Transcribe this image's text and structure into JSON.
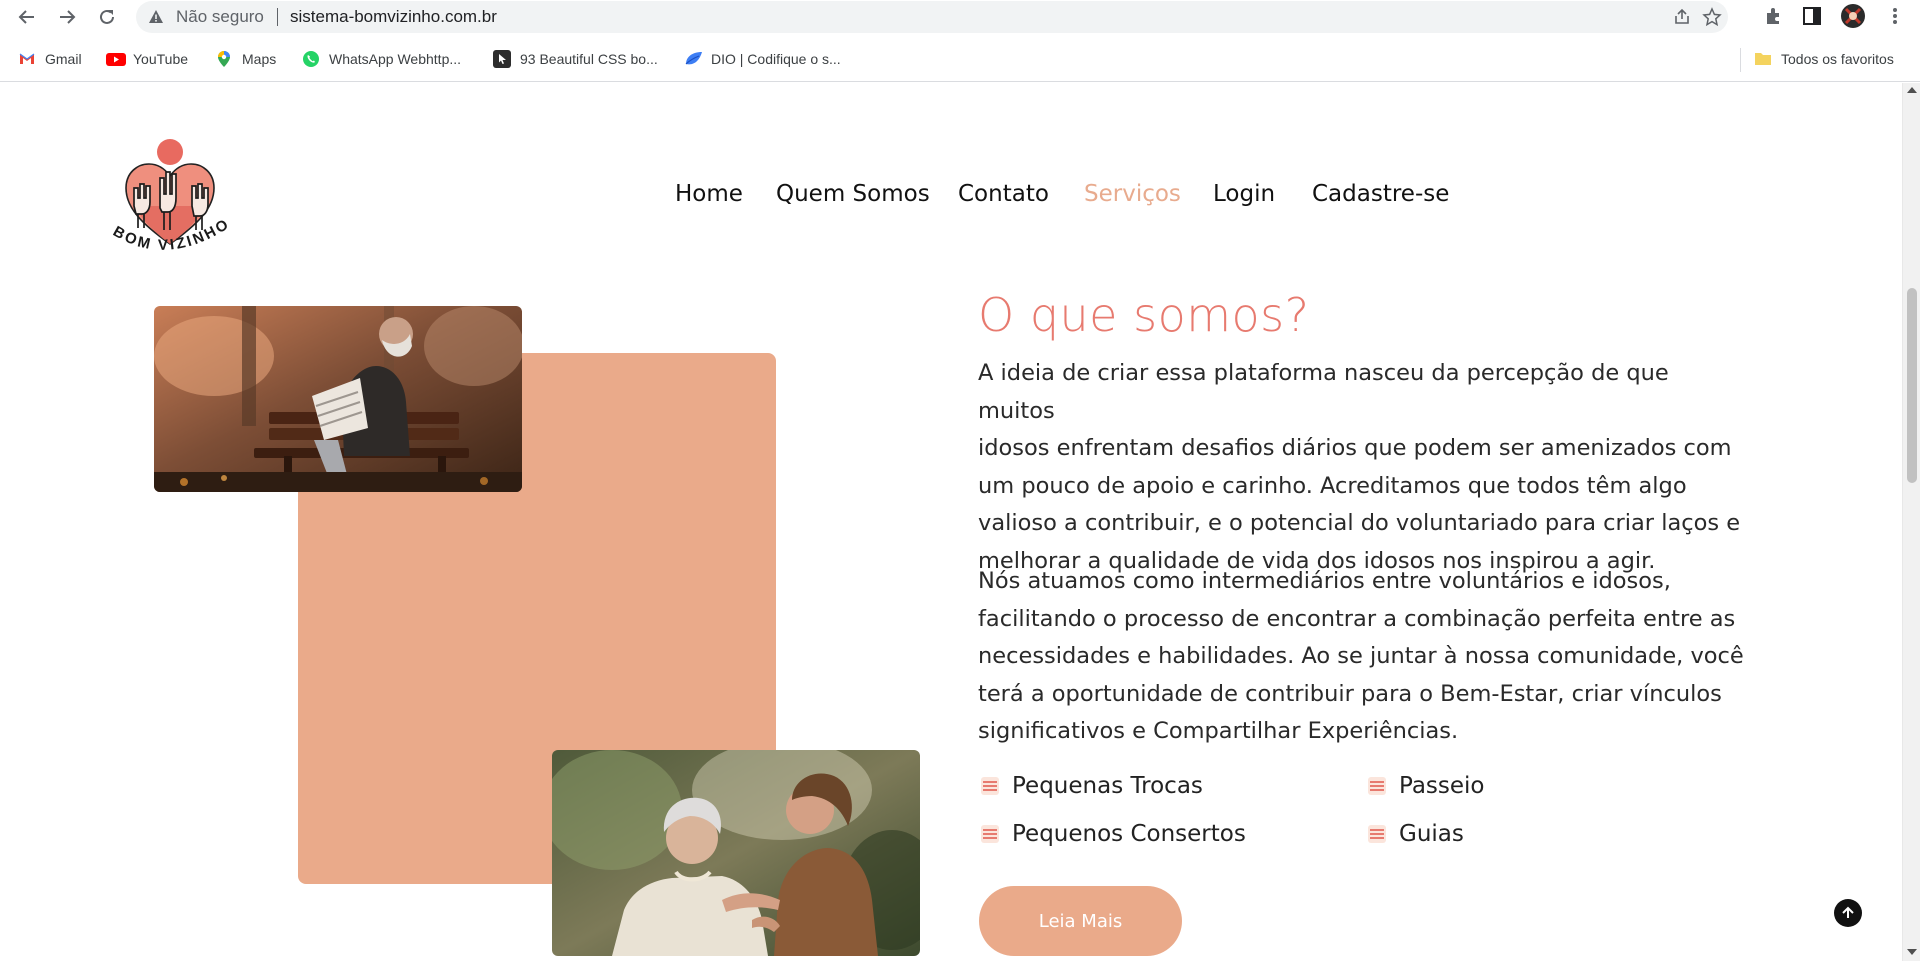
{
  "browser": {
    "not_secure_label": "Não seguro",
    "url": "sistema-bomvizinho.com.br",
    "icons": [
      "back-icon",
      "forward-icon",
      "reload-icon",
      "warning-icon",
      "share-icon",
      "star-icon",
      "extensions-icon",
      "side-panel-icon",
      "profile-icon",
      "menu-icon"
    ],
    "bookmarks": [
      {
        "label": "Gmail",
        "icon": "gmail-icon"
      },
      {
        "label": "YouTube",
        "icon": "youtube-icon"
      },
      {
        "label": "Maps",
        "icon": "maps-icon"
      },
      {
        "label": "WhatsApp Webhttp...",
        "icon": "whatsapp-icon"
      },
      {
        "label": "93 Beautiful CSS bo...",
        "icon": "cursor-icon"
      },
      {
        "label": "DIO | Codifique o s...",
        "icon": "dio-icon"
      }
    ],
    "all_bookmarks_label": "Todos os favoritos"
  },
  "site": {
    "logo_text": "BOM VIZINHO",
    "nav": [
      {
        "label": "Home",
        "active": false
      },
      {
        "label": "Quem Somos",
        "active": false
      },
      {
        "label": "Contato",
        "active": false
      },
      {
        "label": "Serviços",
        "active": true
      },
      {
        "label": "Login",
        "active": false
      },
      {
        "label": "Cadastre-se",
        "active": false
      }
    ],
    "about": {
      "heading": "O que somos?",
      "paragraph1_lines": [
        "A ideia de criar essa plataforma nasceu da percepção de que muitos",
        "idosos enfrentam desafios diários que podem ser amenizados com",
        "um pouco de apoio e carinho. Acreditamos que todos têm algo",
        "valioso a contribuir, e o potencial do voluntariado para criar laços e",
        "melhorar a qualidade de vida dos idosos nos inspirou a agir."
      ],
      "paragraph2_lines": [
        "Nós atuamos como intermediários entre voluntários e idosos,",
        "facilitando o processo de encontrar a combinação perfeita entre as",
        "necessidades e habilidades. Ao se juntar à nossa comunidade, você",
        "terá a oportunidade de contribuir para o Bem-Estar, criar vínculos",
        "significativos e Compartilhar Experiências."
      ],
      "features": [
        "Pequenas Trocas",
        "Passeio",
        "Pequenos Consertos",
        "Guias"
      ],
      "button_label": "Leia Mais"
    }
  },
  "colors": {
    "accent_peach": "#eaaa8a",
    "heading_coral": "#e77a6f",
    "nav_active": "#e8ab8e",
    "text": "#2a2a2a"
  }
}
